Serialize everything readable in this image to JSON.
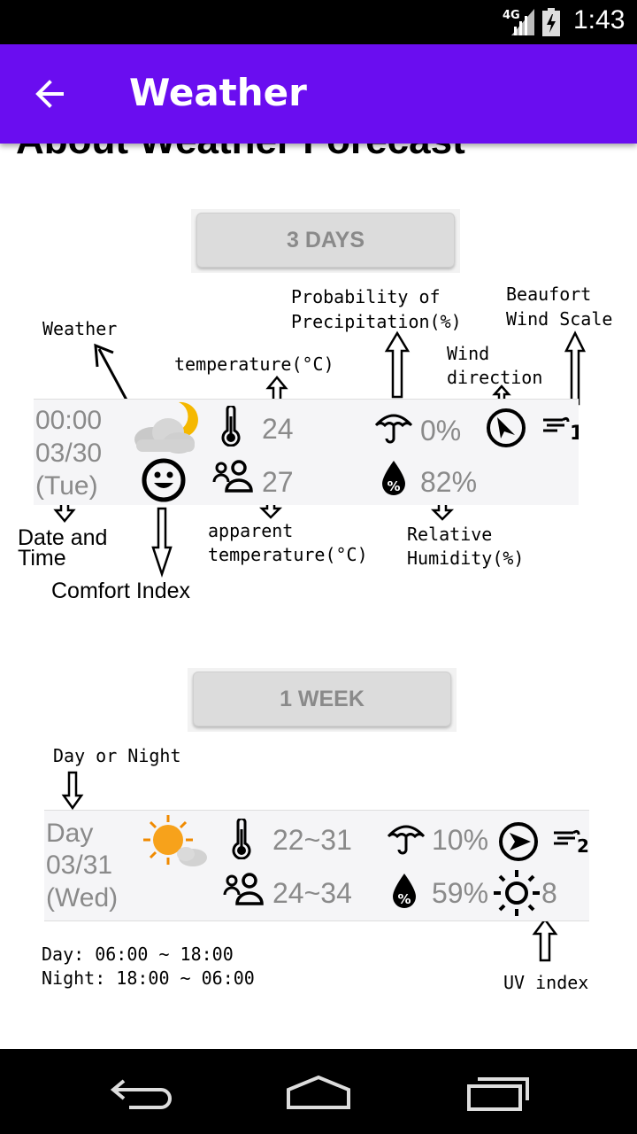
{
  "status_bar": {
    "network": "4G",
    "time": "1:43"
  },
  "app_bar": {
    "title": "Weather"
  },
  "page": {
    "heading": "About Weather Forecast"
  },
  "three_days": {
    "button": "3 DAYS",
    "row": {
      "time": "00:00",
      "date": "03/30",
      "weekday": "(Tue)",
      "temperature": "24",
      "apparent_temperature": "27",
      "precipitation": "0%",
      "humidity": "82%"
    },
    "annotations": {
      "weather": "Weather",
      "temperature": "temperature(°C)",
      "pop_line1": "Probability of",
      "pop_line2": "Precipitation(%)",
      "wind_dir_line1": "Wind",
      "wind_dir_line2": "direction",
      "beaufort_line1": "Beaufort",
      "beaufort_line2": "Wind Scale",
      "date_time_line1": "Date and",
      "date_time_line2": "Time",
      "comfort": "Comfort Index",
      "apparent_line1": "apparent",
      "apparent_line2": "temperature(°C)",
      "humidity_line1": "Relative",
      "humidity_line2": "Humidity(%)"
    }
  },
  "one_week": {
    "button": "1 WEEK",
    "row": {
      "period": "Day",
      "date": "03/31",
      "weekday": "(Wed)",
      "temperature": "22~31",
      "apparent_temperature": "24~34",
      "precipitation": "10%",
      "humidity": "59%",
      "uv": "8"
    },
    "annotations": {
      "day_night": "Day or Night",
      "day_hours": "Day:   06:00 ~ 18:00",
      "night_hours": "Night: 18:00 ~ 06:00",
      "uv": "UV index"
    }
  },
  "icons": {
    "status": [
      "signal-icon",
      "battery-icon"
    ],
    "app_bar": [
      "back-arrow-icon"
    ],
    "row": [
      "cloud-moon-icon",
      "smiley-icon",
      "thermometer-icon",
      "people-icon",
      "umbrella-icon",
      "humidity-drop-icon",
      "wind-direction-icon",
      "wind-scale-icon",
      "sun-cloud-icon",
      "uv-sun-icon"
    ],
    "nav": [
      "back-nav-icon",
      "home-nav-icon",
      "recents-nav-icon"
    ]
  },
  "colors": {
    "app_bar": "#6a0df0",
    "status_bar": "#000000",
    "value_text": "#8a8a8a",
    "button": "#dcdcdc"
  }
}
